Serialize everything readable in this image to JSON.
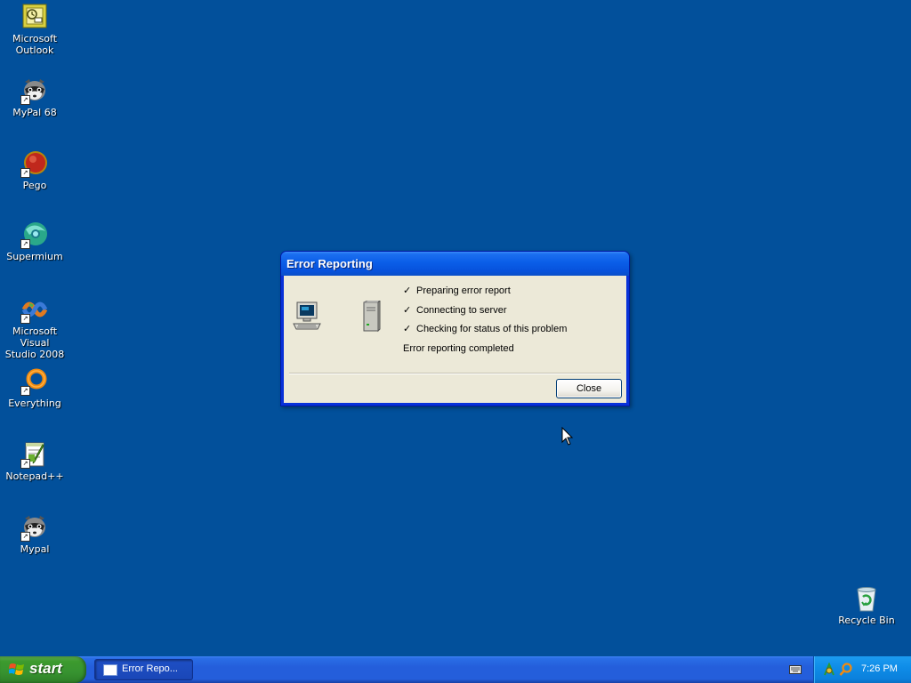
{
  "desktop": {
    "icons": [
      {
        "label": "Microsoft\nOutlook",
        "icon": "outlook-icon"
      },
      {
        "label": "MyPal 68",
        "icon": "raccoon-icon"
      },
      {
        "label": "Pego",
        "icon": "pego-icon"
      },
      {
        "label": "Supermium",
        "icon": "supermium-icon"
      },
      {
        "label": "Microsoft Visual\nStudio 2008",
        "icon": "visual-studio-icon"
      },
      {
        "label": "Everything",
        "icon": "everything-icon"
      },
      {
        "label": "Notepad++",
        "icon": "notepadpp-icon"
      },
      {
        "label": "Mypal",
        "icon": "raccoon-icon"
      },
      {
        "label": "Recycle Bin",
        "icon": "recycle-bin-icon"
      }
    ]
  },
  "dialog": {
    "title": "Error Reporting",
    "steps": [
      "Preparing error report",
      "Connecting to server",
      "Checking for status of this problem"
    ],
    "check_mark": "✓",
    "status": "Error reporting completed",
    "close_label": "Close"
  },
  "taskbar": {
    "start_label": "start",
    "task_label": "Error Repo...",
    "clock": "7:26 PM"
  },
  "colors": {
    "desktop_bg": "#02509b",
    "titlebar": "#0a5ee8",
    "dialog_body": "#ece9d8",
    "taskbar": "#245edb",
    "start_button": "#379330",
    "tray": "#0f8de8"
  }
}
